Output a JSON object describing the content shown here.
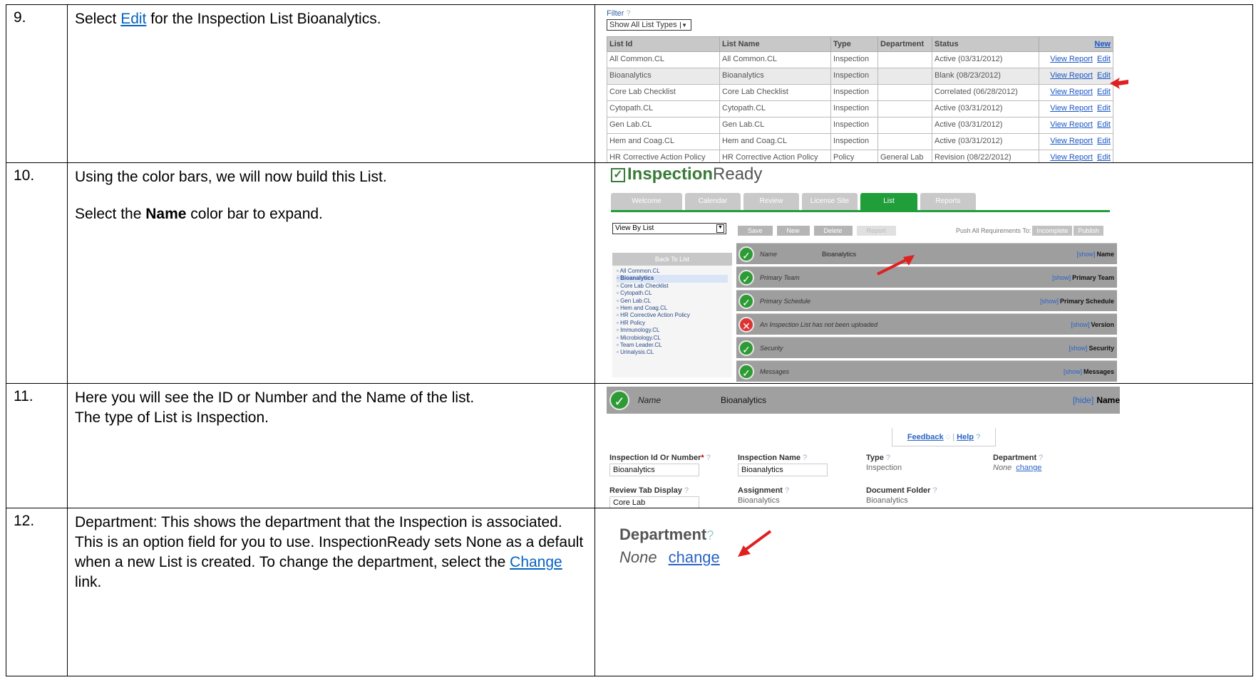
{
  "rows": [
    {
      "num": "9.",
      "text_pre": "Select ",
      "text_link": "Edit",
      "text_post": " for the Inspection List Bioanalytics."
    },
    {
      "num": "10.",
      "line1": "Using the color bars, we will now build this List.",
      "line2_pre": "Select the ",
      "line2_bold": "Name",
      "line2_post": " color bar to expand."
    },
    {
      "num": "11.",
      "line1": "Here you will see the ID or Number and the Name of the list.",
      "line2": "The type of List is Inspection."
    },
    {
      "num": "12.",
      "text_pre": "Department:  This shows the department that the Inspection is associated.  This is an option field for you to use.  InspectionReady sets None as a default when a new List is created.  To change the department, select the ",
      "text_link": "Change",
      "text_post": " link."
    }
  ],
  "shot9": {
    "filter_label": "Filter",
    "filter_q": "?",
    "select_value": "Show All List Types",
    "headers": [
      "List Id",
      "List Name",
      "Type",
      "Department",
      "Status",
      "New"
    ],
    "rows": [
      {
        "id": "All Common.CL",
        "name": "All Common.CL",
        "type": "Inspection",
        "dept": "",
        "status": "Active (03/31/2012)"
      },
      {
        "id": "Bioanalytics",
        "name": "Bioanalytics",
        "type": "Inspection",
        "dept": "",
        "status": "Blank (08/23/2012)"
      },
      {
        "id": "Core Lab Checklist",
        "name": "Core Lab Checklist",
        "type": "Inspection",
        "dept": "",
        "status": "Correlated (06/28/2012)"
      },
      {
        "id": "Cytopath.CL",
        "name": "Cytopath.CL",
        "type": "Inspection",
        "dept": "",
        "status": "Active (03/31/2012)"
      },
      {
        "id": "Gen Lab.CL",
        "name": "Gen Lab.CL",
        "type": "Inspection",
        "dept": "",
        "status": "Active (03/31/2012)"
      },
      {
        "id": "Hem and Coag.CL",
        "name": "Hem and Coag.CL",
        "type": "Inspection",
        "dept": "",
        "status": "Active (03/31/2012)"
      },
      {
        "id": "HR Corrective Action Policy",
        "name": "HR Corrective Action Policy",
        "type": "Policy",
        "dept": "General Lab",
        "status": "Revision (08/22/2012)"
      }
    ],
    "view_report": "View Report",
    "edit": "Edit"
  },
  "shot10": {
    "logo_a": "Inspection",
    "logo_b": "Ready",
    "tabs": [
      "Welcome",
      "Calendar",
      "Review",
      "License Site",
      "List",
      "Reports"
    ],
    "view_select": "View By List",
    "back_to_list": "Back To List",
    "tree": [
      "All Common.CL",
      "Bioanalytics",
      "Core Lab Checklist",
      "Cytopath.CL",
      "Gen Lab.CL",
      "Hem and Coag.CL",
      "HR Corrective Action Policy",
      "HR Policy",
      "Immunology.CL",
      "Microbiology.CL",
      "Team Leader.CL",
      "Urinalysis.CL"
    ],
    "buttons": [
      "Save",
      "New",
      "Delete",
      "Report"
    ],
    "push_label": "Push All Requirements To:",
    "push_buttons": [
      "Incomplete",
      "Publish"
    ],
    "bars": [
      {
        "label": "Name",
        "value": "Bioanalytics",
        "show": "[show]",
        "right": "Name",
        "status": "ok"
      },
      {
        "label": "Primary Team",
        "value": "",
        "show": "[show]",
        "right": "Primary Team",
        "status": "ok"
      },
      {
        "label": "Primary Schedule",
        "value": "",
        "show": "[show]",
        "right": "Primary Schedule",
        "status": "ok"
      },
      {
        "label": "An Inspection List has not been uploaded",
        "value": "",
        "show": "[show]",
        "right": "Version",
        "status": "error"
      },
      {
        "label": "Security",
        "value": "",
        "show": "[show]",
        "right": "Security",
        "status": "ok"
      },
      {
        "label": "Messages",
        "value": "",
        "show": "[show]",
        "right": "Messages",
        "status": "ok"
      }
    ]
  },
  "shot11": {
    "bar_label": "Name",
    "bar_value": "Bioanalytics",
    "hide": "[hide]",
    "bar_right": "Name",
    "feedback": "Feedback",
    "help": "Help",
    "id_label": "Inspection Id Or Number",
    "id_value": "Bioanalytics",
    "name_label": "Inspection Name",
    "name_value": "Bioanalytics",
    "type_label": "Type",
    "type_value": "Inspection",
    "dept_label": "Department",
    "dept_value": "None",
    "change": "change",
    "review_label": "Review Tab Display",
    "review_value": "Core Lab",
    "assign_label": "Assignment",
    "assign_value": "Bioanalytics",
    "folder_label": "Document Folder",
    "folder_value": "Bioanalytics"
  },
  "shot12": {
    "label": "Department",
    "value": "None",
    "change": "change"
  }
}
